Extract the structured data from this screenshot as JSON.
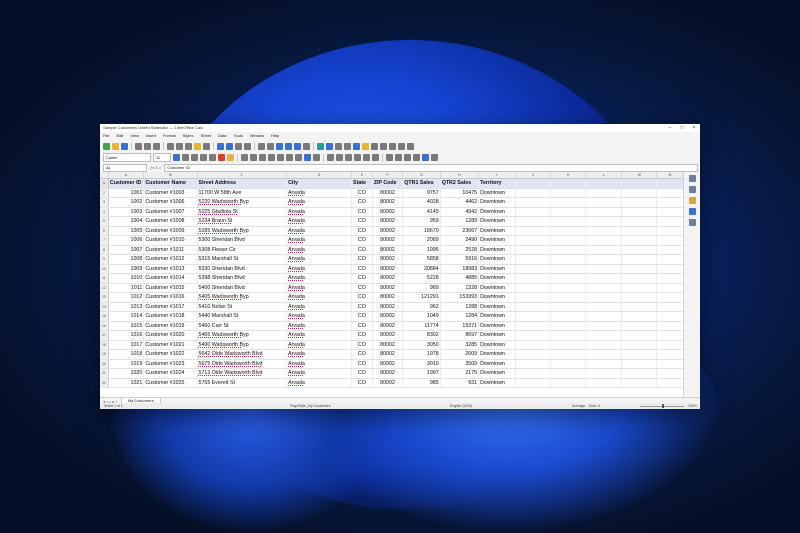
{
  "window": {
    "title": "Sample Customers United Statesdkx — LibreOffice Calc",
    "controls": [
      "–",
      "□",
      "×"
    ]
  },
  "menu": [
    "File",
    "Edit",
    "View",
    "Insert",
    "Format",
    "Styles",
    "Sheet",
    "Data",
    "Tools",
    "Window",
    "Help"
  ],
  "format_bar": {
    "font_name": "Calibri",
    "font_size": "11"
  },
  "formula_bar": {
    "cell_ref": "A1",
    "fx": "ƒx Σ =",
    "content": "Customer ID"
  },
  "columns": [
    "A",
    "B",
    "C",
    "D",
    "E",
    "F",
    "G",
    "H",
    "I",
    "J",
    "K",
    "L",
    "M",
    "N"
  ],
  "headers": [
    "Customer ID",
    "Customer Name",
    "Street Address",
    "City",
    "State",
    "ZIP Code",
    "QTR1 Sales",
    "QTR2 Sales",
    "Territory"
  ],
  "rows": [
    [
      "1001",
      "Customer #1003",
      "11700 W 58th Ave",
      "Arvada",
      "CO",
      "80002",
      "9757",
      "10475",
      "Downtown"
    ],
    [
      "1002",
      "Customer #1006",
      "5220 Wadsworth Byp",
      "Arvada",
      "CO",
      "80002",
      "4028",
      "4462",
      "Downtown"
    ],
    [
      "1003",
      "Customer #1007",
      "5225 Gladiola St",
      "Arvada",
      "CO",
      "80002",
      "4145",
      "4942",
      "Downtown"
    ],
    [
      "1004",
      "Customer #1008",
      "5234 Braun St",
      "Arvada",
      "CO",
      "80002",
      "959",
      "1289",
      "Downtown"
    ],
    [
      "1005",
      "Customer #1009",
      "5285 Wadsworth Byp",
      "Arvada",
      "CO",
      "80002",
      "18670",
      "23067",
      "Downtown"
    ],
    [
      "1006",
      "Customer #1010",
      "5300 Sheridan Blvd",
      "Arvada",
      "CO",
      "80002",
      "2069",
      "2490",
      "Downtown"
    ],
    [
      "1007",
      "Customer #1011",
      "5308 Flower Cir",
      "Arvada",
      "CO",
      "80002",
      "1996",
      "2528",
      "Downtown"
    ],
    [
      "1008",
      "Customer #1012",
      "5315 Marshall St",
      "Arvada",
      "CO",
      "80002",
      "5858",
      "5916",
      "Downtown"
    ],
    [
      "1009",
      "Customer #1013",
      "5330 Sheridan Blvd",
      "Arvada",
      "CO",
      "80002",
      "20884",
      "18983",
      "Downtown"
    ],
    [
      "1010",
      "Customer #1014",
      "5398 Sheridan Blvd",
      "Arvada",
      "CO",
      "80002",
      "5228",
      "4885",
      "Downtown"
    ],
    [
      "1011",
      "Customer #1015",
      "5400 Sheridan Blvd",
      "Arvada",
      "CO",
      "80002",
      "969",
      "1328",
      "Downtown"
    ],
    [
      "1012",
      "Customer #1016",
      "5405 Wadsworth Byp",
      "Arvada",
      "CO",
      "80002",
      "121291",
      "153393",
      "Downtown"
    ],
    [
      "1013",
      "Customer #1017",
      "5410 Nolan St",
      "Arvada",
      "CO",
      "80002",
      "962",
      "1288",
      "Downtown"
    ],
    [
      "1014",
      "Customer #1018",
      "5440 Marshall St",
      "Arvada",
      "CO",
      "80002",
      "1049",
      "1284",
      "Downtown"
    ],
    [
      "1015",
      "Customer #1019",
      "5460 Carr St",
      "Arvada",
      "CO",
      "80002",
      "11774",
      "15371",
      "Downtown"
    ],
    [
      "1016",
      "Customer #1020",
      "5465 Wadsworth Byp",
      "Arvada",
      "CO",
      "80002",
      "8302",
      "8697",
      "Downtown"
    ],
    [
      "1017",
      "Customer #1021",
      "5490 Wadsworth Byp",
      "Arvada",
      "CO",
      "80002",
      "3050",
      "3285",
      "Downtown"
    ],
    [
      "1018",
      "Customer #1022",
      "5642 Olde Wadsworth Blvd",
      "Arvada",
      "CO",
      "80002",
      "1978",
      "2009",
      "Downtown"
    ],
    [
      "1019",
      "Customer #1023",
      "5675 Olde Wadsworth Blvd",
      "Arvada",
      "CO",
      "80002",
      "3010",
      "3509",
      "Downtown"
    ],
    [
      "1020",
      "Customer #1024",
      "5713 Olde Wadsworth Blvd",
      "Arvada",
      "CO",
      "80002",
      "1997",
      "2175",
      "Downtown"
    ],
    [
      "1021",
      "Customer #1025",
      "5755 Everett St",
      "Arvada",
      "CO",
      "80002",
      "985",
      "931",
      "Downtown"
    ]
  ],
  "sheet_tabs": {
    "nav": "◂ ◃ ▹ ▸ +",
    "active": "My Customers"
  },
  "status": {
    "sheet": "Sheet 1 of 1",
    "page_style": "PageStyle_My Customers",
    "language": "English (USA)",
    "summary": "Average: ; Sum: 0",
    "zoom": "150%"
  }
}
